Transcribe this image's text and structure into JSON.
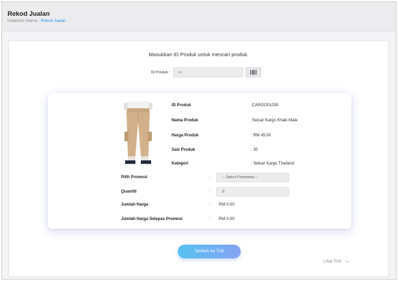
{
  "header": {
    "title": "Rekod Jualan",
    "breadcrumb": {
      "home": "Halaman Utama",
      "separator": " - ",
      "current": "Rekod Jualan"
    }
  },
  "search": {
    "prompt": "Masukkan ID Produk untuk mencari produk.",
    "id_label": "ID Produk :",
    "id_value": "co",
    "barcode_icon": "barcode-icon"
  },
  "product": {
    "image_icon": "khaki-cargo-pants-photo",
    "fields": [
      {
        "label": "ID Produk",
        "value": ":CARGO01030"
      },
      {
        "label": "Nama Produk",
        "value": ":Seluar Kargo Khaki Male"
      },
      {
        "label": "Harga Produk",
        "value": ": RM 45.00"
      },
      {
        "label": "Saiz Produk",
        "value": ": 30"
      },
      {
        "label": "Kategori",
        "value": ": Seluar Kargo Thailand"
      }
    ]
  },
  "form": {
    "promo_label": "Pilih Promosi",
    "promo_placeholder": "-- Select Promotion --",
    "qty_label": "Quantiti",
    "qty_value": "0",
    "total_label": "Jumlah Harga",
    "total_value": "RM 0.00",
    "total_after_label": "Jumlah Harga Selepas Promosi",
    "total_after_value": "RM 0.00",
    "colon": ":"
  },
  "actions": {
    "add_to_cart": "Tambah Ke Troli",
    "view_cart": "Lihat Troli",
    "arrow_icon": "arrow-right-icon"
  },
  "colors": {
    "accent_link": "#2d95e6",
    "button_gradient_start": "#56c2f0",
    "button_gradient_end": "#86a2f3"
  }
}
